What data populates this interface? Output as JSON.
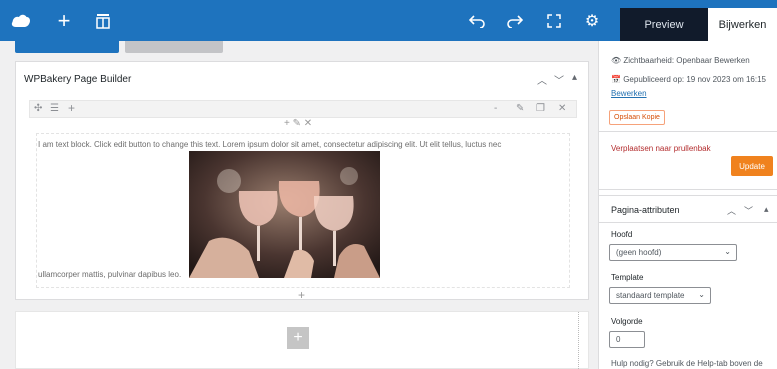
{
  "topbar": {
    "preview_label": "Preview",
    "update_label": "Bijwerken"
  },
  "builder": {
    "title": "WPBakery Page Builder",
    "text_line": "I am text block. Click edit button to change this text. Lorem ipsum dolor sit amet, consectetur adipiscing elit. Ut elit tellus, luctus nec",
    "text_line_end": "ullamcorper mattis, pulvinar dapibus leo."
  },
  "sidebar": {
    "status_label": "Zichtbaarheid: Openbaar Bewerken",
    "published_label": "Gepubliceerd op: 19 nov 2023 om 16:15",
    "edit_link": "Bewerken",
    "copy_button": "Opslaan Kopie",
    "trash_link": "Verplaatsen naar prullenbak",
    "update_button": "Update",
    "attributes_title": "Pagina-attributen",
    "parent_label": "Hoofd",
    "parent_value": "(geen hoofd)",
    "template_label": "Template",
    "template_value": "standaard template",
    "order_label": "Volgorde",
    "order_value": "0",
    "help_text": "Hulp nodig? Gebruik de Help-tab boven de"
  },
  "colors": {
    "topbar": "#1e73be",
    "preview_bg": "#111b2b",
    "update_btn": "#f0821e",
    "link": "#2271b1"
  }
}
